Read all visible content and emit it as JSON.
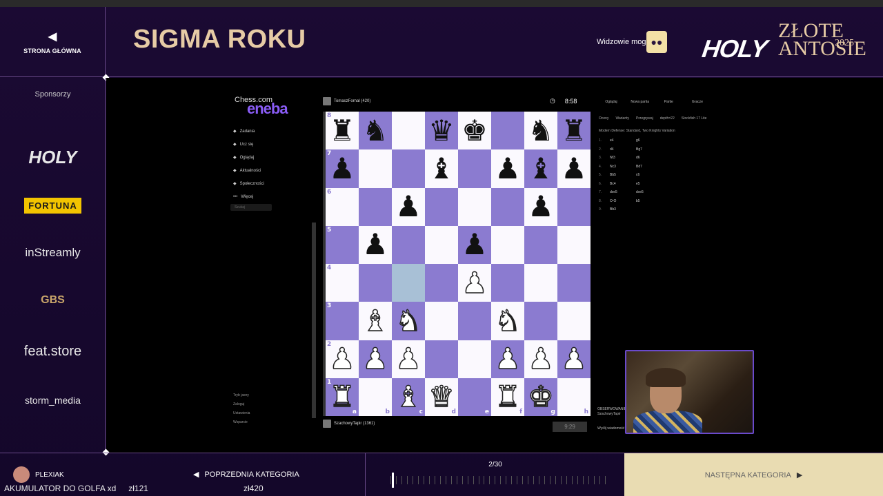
{
  "header": {
    "home_label": "STRONA GŁÓWNA",
    "title": "SIGMA ROKU",
    "viewers_label": "Widzowie mogą",
    "logo_holy": "HOLY",
    "logo_line1": "ZŁOTE",
    "logo_line2": "ANTOSIE",
    "logo_year": "2025"
  },
  "sidebar": {
    "title": "Sponsorzy",
    "sponsors": [
      "HOLY",
      "FORTUNA",
      "inStreamly",
      "GBS",
      "feat.store",
      "storm_media"
    ]
  },
  "chess": {
    "site_logo": "Chess.com",
    "ad_logo": "eneba",
    "menu": [
      "Zadania",
      "Ucz się",
      "Oglądaj",
      "Aktualności",
      "Społeczności",
      "Więcej"
    ],
    "search_placeholder": "Szukaj",
    "bottom_menu": [
      "Tryb jasny",
      "Zaloguj",
      "Ustawienia",
      "Wsparcie"
    ],
    "top_player": "TomaszFornal (420)",
    "top_clock": "8:58",
    "bottom_player": "SzachowyTapir (1361)",
    "bottom_clock": "9:29",
    "ranks": [
      "8",
      "7",
      "6",
      "5",
      "4",
      "3",
      "2",
      "1"
    ],
    "files": [
      "a",
      "b",
      "c",
      "d",
      "e",
      "f",
      "g",
      "h"
    ],
    "board": [
      [
        "♜",
        "♞",
        "",
        "♛",
        "♚",
        "",
        "♞",
        "♜"
      ],
      [
        "♟",
        "",
        "",
        "♝",
        "",
        "♟",
        "♝",
        "♟"
      ],
      [
        "",
        "",
        "♟",
        "",
        "",
        "",
        "♟",
        ""
      ],
      [
        "",
        "♟",
        "",
        "",
        "♟",
        "",
        "",
        ""
      ],
      [
        "",
        "",
        "",
        "",
        "♙",
        "",
        "",
        ""
      ],
      [
        "",
        "♗",
        "♘",
        "",
        "",
        "♘",
        "",
        ""
      ],
      [
        "♙",
        "♙",
        "♙",
        "",
        "",
        "♙",
        "♙",
        "♙"
      ],
      [
        "♖",
        "",
        "♗",
        "♕",
        "",
        "♖",
        "♔",
        ""
      ]
    ],
    "highlight": "c4",
    "tabs": [
      "Oglądaj",
      "Nowa partia",
      "Partie",
      "Gracze"
    ],
    "toggles": [
      "Oceny",
      "Warianty",
      "Przegrywaj",
      "depth=22",
      "Stockfish 17 Lite"
    ],
    "opening": "Modern Defense: Standard, Two Knights Variation",
    "moves": [
      [
        "1.",
        "e4",
        "g6"
      ],
      [
        "2.",
        "d4",
        "Bg7"
      ],
      [
        "3.",
        "Nf3",
        "d6"
      ],
      [
        "4.",
        "Nc3",
        "Bd7"
      ],
      [
        "5.",
        "Bb5",
        "c6"
      ],
      [
        "6.",
        "Bc4",
        "e5"
      ],
      [
        "7.",
        "dxe5",
        "dxe5"
      ],
      [
        "8.",
        "O-O",
        "b5"
      ],
      [
        "9.",
        "Bb3",
        ""
      ]
    ],
    "chat_lines": [
      "OBSERWOWANIE",
      "SzachowyTapir",
      "Wyślij wiadomość"
    ]
  },
  "footer": {
    "player_name": "PLEXIAK",
    "ticker": [
      "AKUMULATOR DO GOLFA xd",
      "zł121",
      "zł420"
    ],
    "prev_label": "POPRZEDNIA KATEGORIA",
    "progress_label": "2/30",
    "progress": 0.0667,
    "next_label": "NASTĘPNA KATEGORIA"
  }
}
